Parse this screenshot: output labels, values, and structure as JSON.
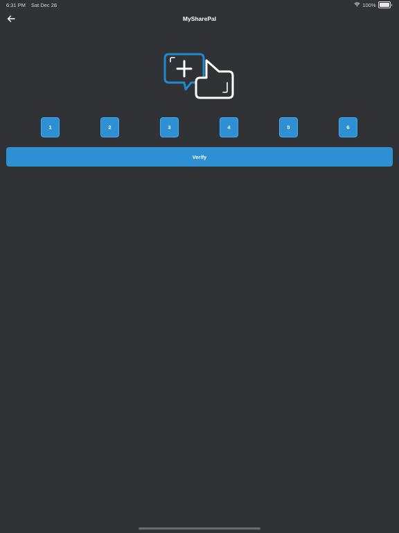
{
  "status_bar": {
    "time": "6:31 PM",
    "date": "Sat Dec 28",
    "battery": "100%",
    "wifi_icon": "wifi-icon",
    "battery_icon": "battery-icon"
  },
  "nav": {
    "back_icon": "arrow-left-icon",
    "title": "MySharePal"
  },
  "logo": {
    "icon": "chat-plus-hand-logo",
    "colors": {
      "bubble": "#1f8ad1",
      "hand": "#ffffff"
    }
  },
  "code_digits": [
    "1",
    "2",
    "3",
    "4",
    "5",
    "6"
  ],
  "verify_label": "Verify",
  "colors": {
    "background": "#303236",
    "accent": "#2f8fd3",
    "text": "#ffffff"
  }
}
